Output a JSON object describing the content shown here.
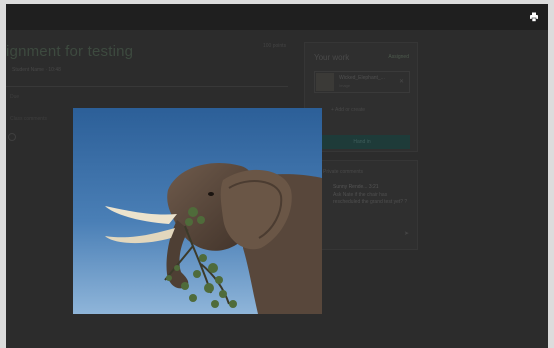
{
  "window": {
    "print_icon": "printer-icon"
  },
  "background": {
    "assignment_title": "ignment for testing",
    "points": "100 points",
    "meta": "Student Name · 10:48",
    "faint_line_1": "Due",
    "faint_line_2": "Class comments",
    "your_work": {
      "heading": "Your work",
      "status": "Assigned",
      "file_name": "Wicked_Elephant_...",
      "file_type": "Image",
      "add_label": "+ Add or create",
      "submit_label": "Hand in"
    },
    "private_comments": {
      "heading": "Private comments",
      "author": "Sunny Rende...  3:21",
      "text": "Ask Nate if the chair has rescheduled the grand test yet? ?"
    }
  },
  "viewer": {
    "image_subject": "elephant-photo"
  },
  "colors": {
    "overlay": "#2b2b2b",
    "topbar": "#1f1f1f",
    "submit_button": "#1e3b39",
    "sky": "#3f70a5"
  }
}
